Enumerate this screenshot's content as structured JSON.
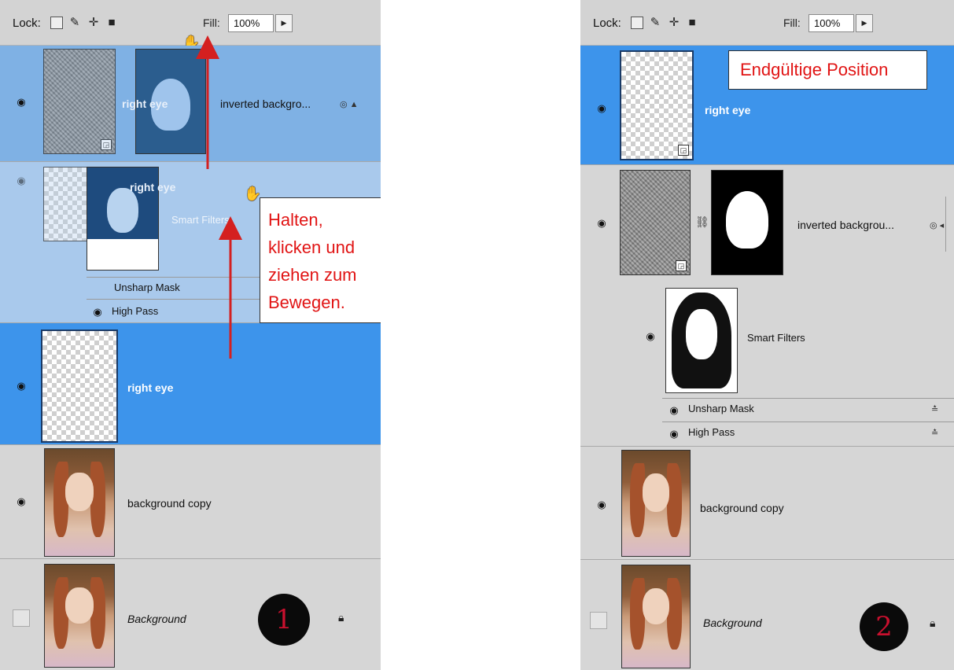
{
  "left_panel": {
    "lock_label": "Lock:",
    "fill_label": "Fill:",
    "fill_value": "100%",
    "layers": {
      "inverted_name": "inverted backgro...",
      "drag_ghost_name": "right eye",
      "right_eye_ghost": "right eye",
      "smart_filters": "Smart Filters",
      "unsharp_mask": "Unsharp Mask",
      "high_pass": "High Pass",
      "right_eye": "right eye",
      "background_copy": "background copy",
      "background": "Background"
    },
    "step_number": "1",
    "callout": "Halten,\nklicken und\nziehen zum\nBewegen."
  },
  "right_panel": {
    "lock_label": "Lock:",
    "fill_label": "Fill:",
    "fill_value": "100%",
    "layers": {
      "right_eye": "right eye",
      "inverted_name": "inverted backgrou...",
      "smart_filters": "Smart Filters",
      "unsharp_mask": "Unsharp Mask",
      "high_pass": "High Pass",
      "background_copy": "background copy",
      "background": "Background"
    },
    "step_number": "2",
    "callout": "Endgültige Position"
  },
  "colors": {
    "selected_layer": "#3d94eb",
    "drag_highlight": "#7fb1e4",
    "callout_text": "#e11414",
    "arrow": "#d42020"
  },
  "icons": [
    "eye-icon",
    "lock-transparent-icon",
    "lock-brush-icon",
    "lock-move-icon",
    "lock-all-icon",
    "smart-object-icon",
    "chain-link-icon",
    "filter-options-icon",
    "layer-lock-icon",
    "grab-hand-icon"
  ]
}
